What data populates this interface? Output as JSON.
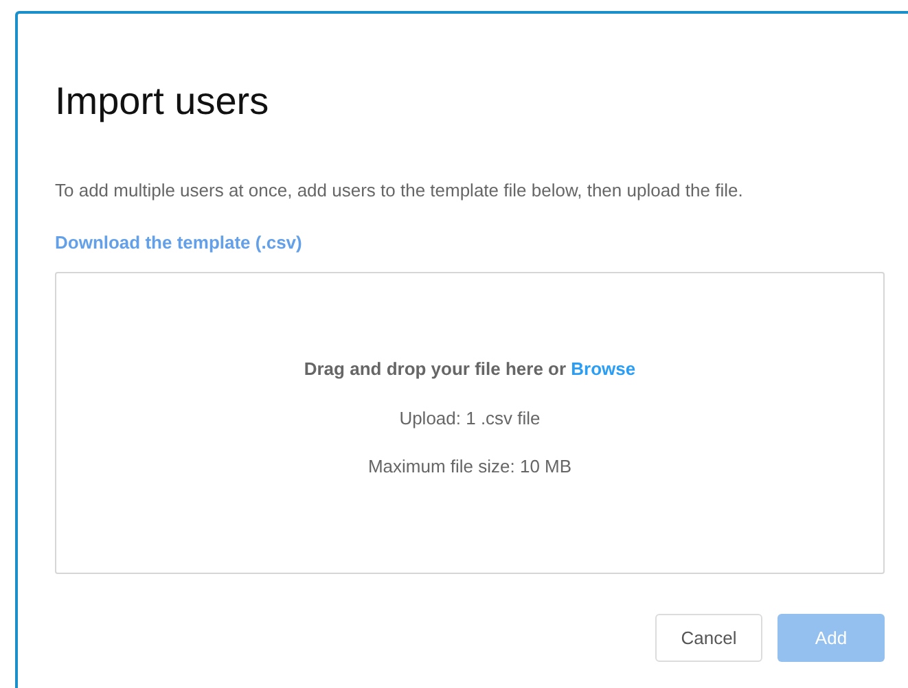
{
  "dialog": {
    "title": "Import users",
    "description": "To add multiple users at once, add users to the template file below, then upload the file.",
    "template_link": "Download the template (.csv)",
    "dropzone": {
      "prompt": "Drag and drop your file here or",
      "browse_link": "Browse",
      "upload_hint": "Upload: 1 .csv file",
      "size_hint": "Maximum file size: 10 MB"
    },
    "buttons": [
      {
        "kind": "secondary",
        "label": "Cancel",
        "disabled": false
      },
      {
        "kind": "primary",
        "label": "Add",
        "disabled": true
      }
    ]
  }
}
